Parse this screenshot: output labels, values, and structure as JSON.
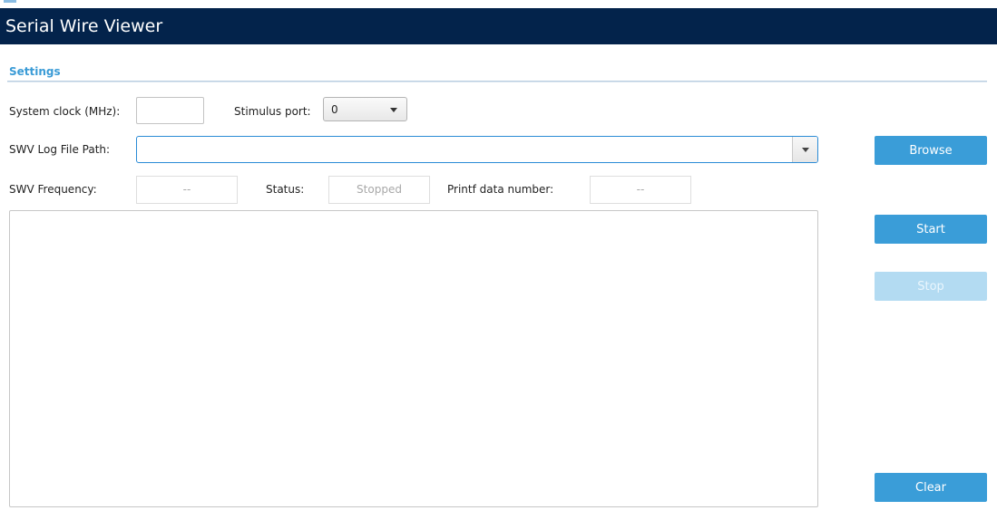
{
  "window": {
    "title": "Serial Wire Viewer"
  },
  "settings": {
    "section_title": "Settings",
    "system_clock": {
      "label": "System clock (MHz):",
      "value": ""
    },
    "stimulus_port": {
      "label": "Stimulus port:",
      "selected": "0"
    },
    "log_file_path": {
      "label": "SWV Log File Path:",
      "value": ""
    },
    "swv_frequency": {
      "label": "SWV Frequency:",
      "value": "--"
    },
    "status": {
      "label": "Status:",
      "value": "Stopped"
    },
    "printf_data_number": {
      "label": "Printf data number:",
      "value": "--"
    }
  },
  "buttons": {
    "browse": "Browse",
    "start": "Start",
    "stop": "Stop",
    "clear": "Clear"
  },
  "log": {
    "content": ""
  },
  "colors": {
    "title_bar": "#03234b",
    "accent": "#3a9dd8",
    "accent_disabled": "#b3dbf2",
    "section_title": "#3a9bd6"
  },
  "icons": {
    "stimulus_dropdown": "chevron-down-icon",
    "path_dropdown": "chevron-down-icon"
  }
}
